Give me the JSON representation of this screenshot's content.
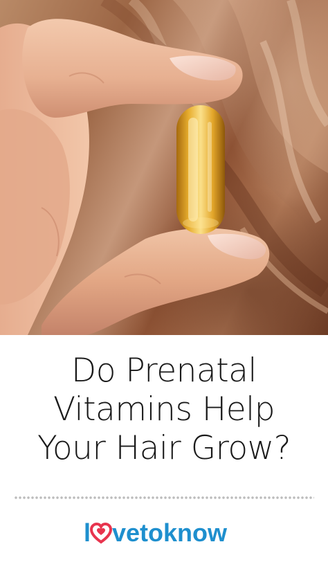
{
  "image": {
    "alt": "fingers holding a softgel capsule",
    "palette": {
      "background": "#ffffff",
      "skin": "#e9b495",
      "capsule": "#e8b12c",
      "hair": "#9c6645"
    }
  },
  "title": {
    "lines": [
      "Do Prenatal",
      "Vitamins Help",
      "Your Hair Grow?"
    ]
  },
  "logo": {
    "text": "lovetoknow",
    "heart_color": "#e8344e",
    "text_color": "#1e8fce",
    "icon": "heart-icon"
  }
}
